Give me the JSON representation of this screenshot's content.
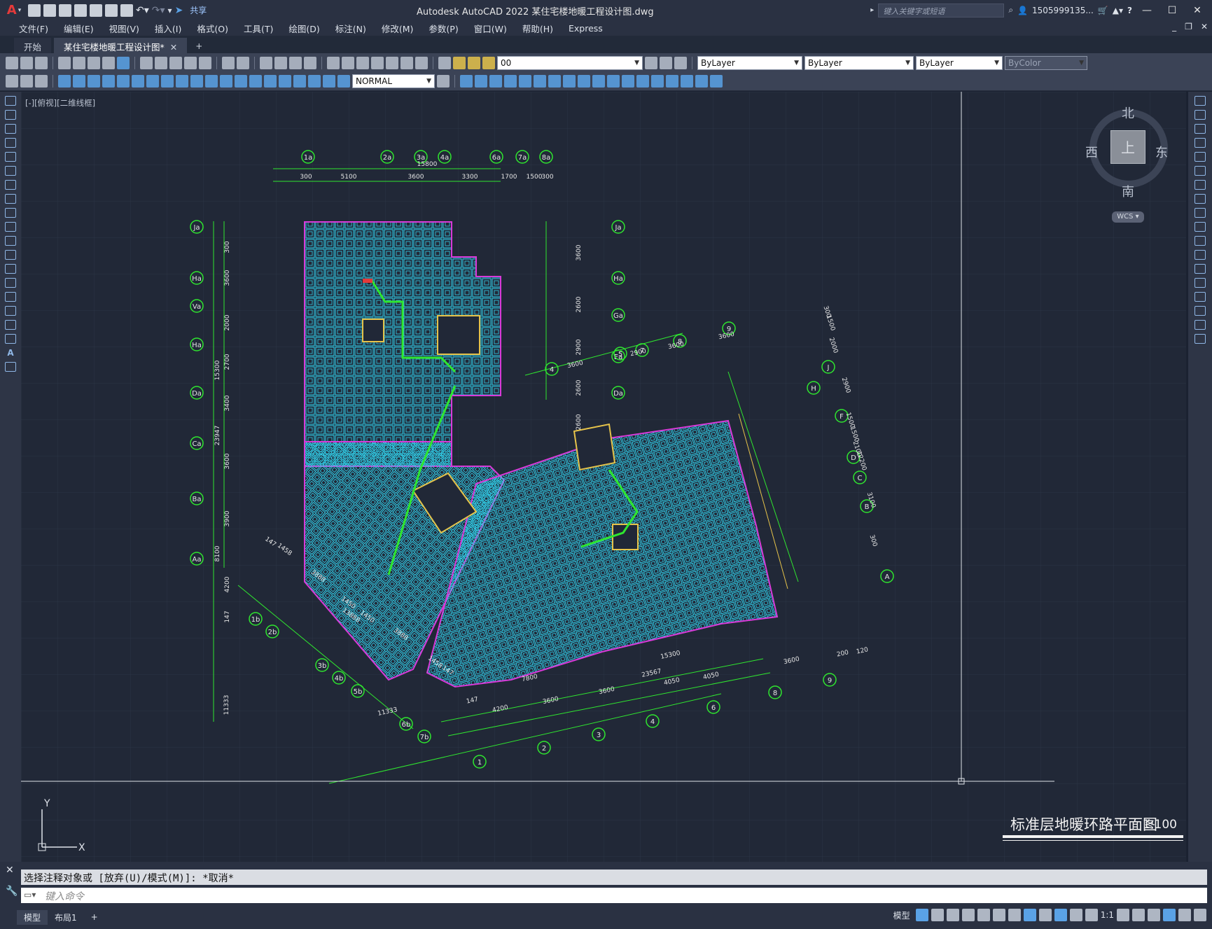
{
  "app": {
    "title": "Autodesk AutoCAD 2022    某住宅楼地暖工程设计图.dwg",
    "logo": "A",
    "share_label": "共享",
    "search_placeholder": "键入关键字或短语",
    "user": "1505999135...",
    "help": "?"
  },
  "menu": [
    "文件(F)",
    "编辑(E)",
    "视图(V)",
    "插入(I)",
    "格式(O)",
    "工具(T)",
    "绘图(D)",
    "标注(N)",
    "修改(M)",
    "参数(P)",
    "窗口(W)",
    "帮助(H)",
    "Express"
  ],
  "tabs": [
    {
      "label": "开始",
      "active": false
    },
    {
      "label": "某住宅楼地暖工程设计图*",
      "active": true
    }
  ],
  "toolbar": {
    "layer_value": "00",
    "color_value": "ByLayer",
    "linetype_value": "ByLayer",
    "lineweight_value": "ByLayer",
    "plotstyle_value": "ByColor",
    "dimstyle_value": "NORMAL"
  },
  "viewport": {
    "label": "[-][俯视][二维线框]",
    "compass": {
      "north": "北",
      "south": "南",
      "west": "西",
      "east": "东",
      "top": "上"
    },
    "wcs": "WCS",
    "ucs_x": "X",
    "ucs_y": "Y"
  },
  "drawing": {
    "title": "标准层地暖环路平面图",
    "scale": "1:100",
    "grid_top": [
      "1a",
      "2a",
      "3a",
      "4a",
      "6a",
      "7a",
      "8a"
    ],
    "grid_left": [
      "Ja",
      "Ha",
      "Va",
      "Ha",
      "Da",
      "Ca",
      "Ba",
      "Aa"
    ],
    "grid_right_top": [
      "Ja",
      "Ha",
      "Ga",
      "Ea",
      "Da"
    ],
    "grid_lower_right": [
      "J",
      "H",
      "F",
      "D",
      "C",
      "B",
      "A"
    ],
    "grid_bottom": [
      "1",
      "2",
      "3",
      "4",
      "6",
      "8",
      "9"
    ],
    "grid_upper_diag": [
      "4",
      "5",
      "7",
      "8",
      "9"
    ],
    "grid_lower_left": [
      "1b",
      "2b",
      "3b",
      "4b",
      "5b",
      "6b",
      "7b"
    ],
    "dims_top": [
      "300",
      "5100",
      "3600",
      "3300",
      "1700",
      "1500",
      "300"
    ],
    "dim_top_total": "15800",
    "dims_left": [
      "300",
      "3600",
      "2000",
      "2700",
      "3400",
      "3600",
      "3900",
      "4200",
      "147"
    ],
    "dims_left_totals": [
      "15300",
      "23947",
      "8100",
      "11333"
    ],
    "dims_right_top": [
      "3600",
      "2600",
      "2900",
      "2600",
      "2600"
    ],
    "dims_bottom": [
      "4200",
      "3600",
      "3600",
      "4050",
      "4050",
      "3600",
      "200",
      "120"
    ],
    "dims_bottom_totals": [
      "7800",
      "15300",
      "23567",
      "11333",
      "147"
    ],
    "dims_upper_diag": [
      "2900",
      "3600",
      "3600",
      "3600"
    ],
    "dims_lower_right": [
      "300",
      "1500",
      "2000",
      "2900",
      "1500",
      "1500",
      "2100",
      "12200",
      "3100",
      "300"
    ],
    "dims_lower_left": [
      "147",
      "1458",
      "3888",
      "1450",
      "1450",
      "13888",
      "3888",
      "1458",
      "147"
    ]
  },
  "command": {
    "history": "选择注释对象或 [放弃(U)/模式(M)]: *取消*",
    "placeholder": "键入命令"
  },
  "status": {
    "tabs": [
      {
        "label": "模型",
        "active": true
      },
      {
        "label": "布局1",
        "active": false
      }
    ],
    "add": "+",
    "model_label": "模型",
    "scale": "1:1"
  },
  "colors": {
    "background": "#212837",
    "accent_cyan": "#31d4ef",
    "grid_green": "#2fe62f",
    "wall_magenta": "#d83ad8",
    "accent_yellow": "#e6c34a"
  }
}
